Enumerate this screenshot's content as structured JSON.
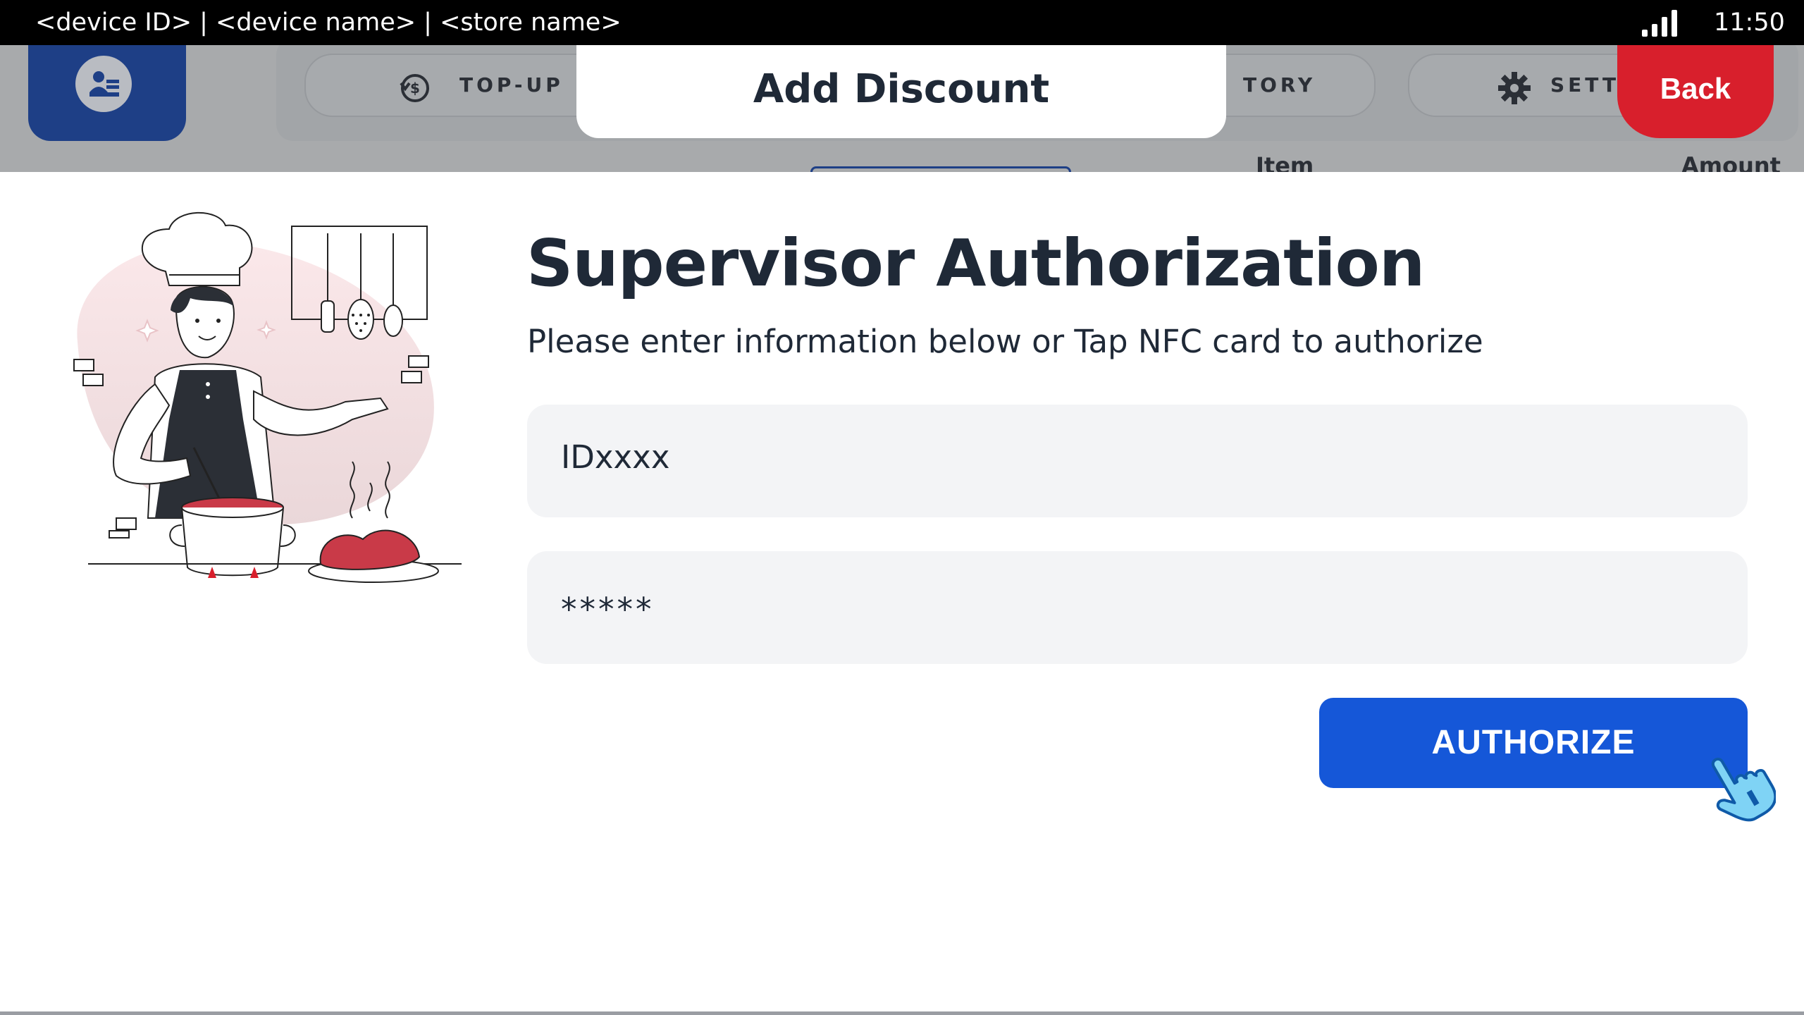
{
  "status_bar": {
    "device_info": "<device ID> | <device name> | <store name>",
    "time": "11:50",
    "signal_icon": "signal-bars-icon"
  },
  "background": {
    "nav": [
      {
        "label": "TOP-UP",
        "icon": "coin-refresh-icon"
      },
      {
        "label": "TORY",
        "icon": ""
      },
      {
        "label": "SETTI",
        "icon": "gear-icon"
      }
    ],
    "columns": {
      "item": "Item",
      "amount": "Amount"
    }
  },
  "dialog": {
    "title": "Add Discount",
    "back_label": "Back",
    "heading": "Supervisor Authorization",
    "subheading": "Please enter information below or Tap NFC card to authorize",
    "id_field": {
      "value": "IDxxxx"
    },
    "password_field": {
      "value": "*****"
    },
    "authorize_label": "AUTHORIZE"
  },
  "colors": {
    "primary": "#1557d8",
    "danger": "#d81f2c",
    "brand_dark": "#1e3f86",
    "field_bg": "#f3f4f6"
  }
}
